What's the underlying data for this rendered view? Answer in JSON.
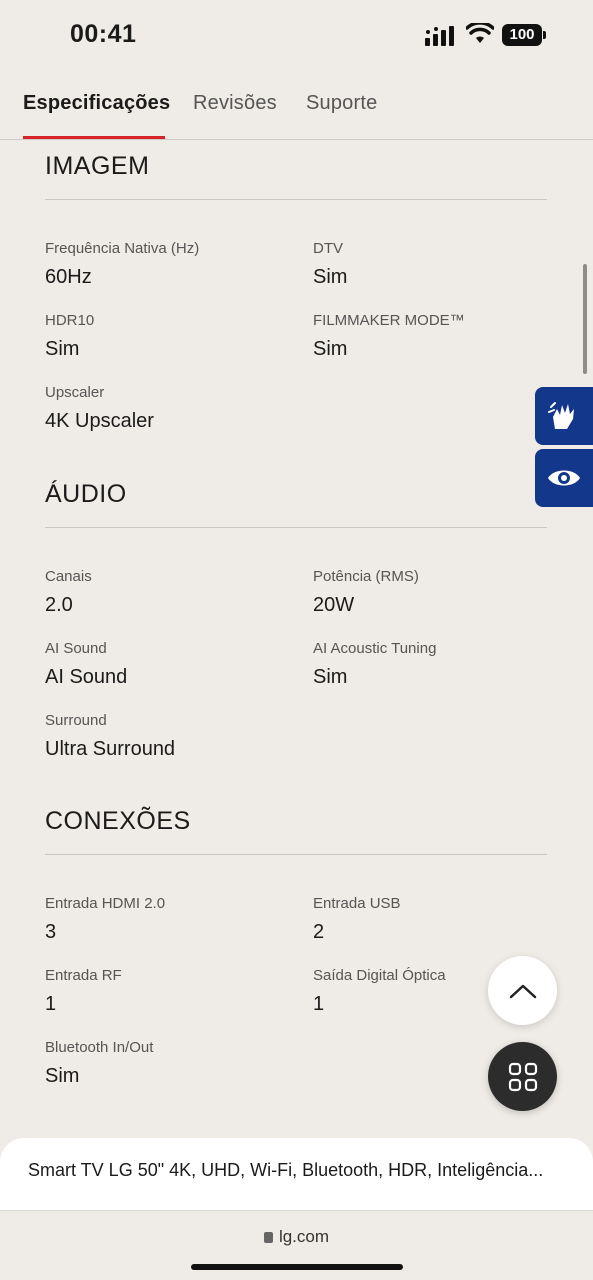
{
  "status_bar": {
    "time": "00:41",
    "battery": "100"
  },
  "tabs": [
    {
      "label": "Especificações"
    },
    {
      "label": "Revisões"
    },
    {
      "label": "Suporte"
    }
  ],
  "sections": [
    {
      "title": "IMAGEM",
      "specs": [
        {
          "label": "Frequência Nativa (Hz)",
          "value": "60Hz"
        },
        {
          "label": "DTV",
          "value": "Sim"
        },
        {
          "label": "HDR10",
          "value": "Sim"
        },
        {
          "label": "FILMMAKER MODE™",
          "value": "Sim"
        },
        {
          "label": "Upscaler",
          "value": "4K Upscaler"
        }
      ]
    },
    {
      "title": "ÁUDIO",
      "specs": [
        {
          "label": "Canais",
          "value": "2.0"
        },
        {
          "label": "Potência (RMS)",
          "value": "20W"
        },
        {
          "label": "AI Sound",
          "value": "AI Sound"
        },
        {
          "label": "AI Acoustic Tuning",
          "value": "Sim"
        },
        {
          "label": "Surround",
          "value": "Ultra Surround"
        }
      ]
    },
    {
      "title": "CONEXÕES",
      "specs": [
        {
          "label": "Entrada HDMI 2.0",
          "value": "3"
        },
        {
          "label": "Entrada USB",
          "value": "2"
        },
        {
          "label": "Entrada RF",
          "value": "1"
        },
        {
          "label": "Saída Digital Óptica",
          "value": "1"
        },
        {
          "label": "Bluetooth In/Out",
          "value": "Sim"
        }
      ]
    }
  ],
  "product_bar": {
    "name": "Smart TV LG 50\" 4K, UHD, Wi-Fi, Bluetooth, HDR, Inteligência..."
  },
  "address_bar": {
    "url": "lg.com"
  },
  "accent_color": "#d8222a",
  "a11y_color": "#13378a"
}
